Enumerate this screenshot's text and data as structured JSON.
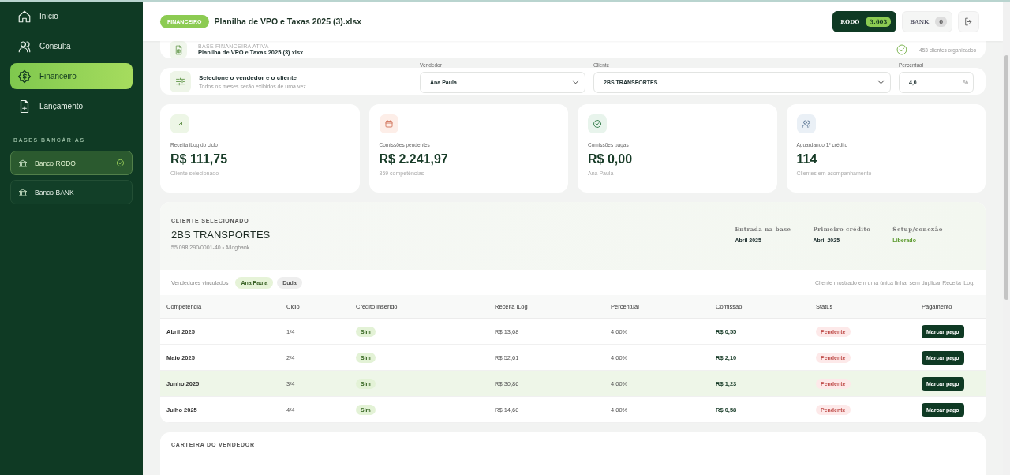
{
  "sidebar": {
    "nav": [
      {
        "label": "Início",
        "selected": false
      },
      {
        "label": "Consulta",
        "selected": false
      },
      {
        "label": "Financeiro",
        "selected": true
      },
      {
        "label": "Lançamento",
        "selected": false
      }
    ],
    "section_title": "BASES BANCÁRIAS",
    "banks": [
      {
        "label": "Banco RODO",
        "selected": true
      },
      {
        "label": "Banco BANK",
        "selected": false
      }
    ]
  },
  "header": {
    "tag": "FINANCEIRO",
    "title": "Planilha de VPO e Taxas 2025 (3).xlsx",
    "bases": [
      {
        "label": "RODO",
        "count": "3.603",
        "selected": true
      },
      {
        "label": "BANK",
        "count": "0",
        "selected": false
      }
    ]
  },
  "active_base": {
    "label": "BASE FINANCEIRA ATIVA",
    "file": "Planilha de VPO e Taxas 2025 (3).xlsx",
    "status": "453 clientes organizados"
  },
  "filter": {
    "title": "Selecione o vendedor e o cliente",
    "subtitle": "Todos os meses serão exibidos de uma vez.",
    "vendedor": {
      "label": "Vendedor",
      "value": "Ana Paula"
    },
    "cliente": {
      "label": "Cliente",
      "value": "2BS TRANSPORTES"
    },
    "percentual": {
      "label": "Percentual",
      "value": "4,0",
      "suffix": "%"
    }
  },
  "stats": [
    {
      "label": "Receita iLog do ciclo",
      "value": "R$ 111,75",
      "note": "Cliente selecionado"
    },
    {
      "label": "Comissões pendentes",
      "value": "R$ 2.241,97",
      "note": "359 competências"
    },
    {
      "label": "Comissões pagas",
      "value": "R$ 0,00",
      "note": "Ana Paula"
    },
    {
      "label": "Aguardando 1º crédito",
      "value": "114",
      "note": "Clientes em acompanhamento"
    }
  ],
  "client": {
    "section_label": "CLIENTE SELECIONADO",
    "name": "2BS TRANSPORTES",
    "document": "55.098.290/0001-40 • Ailogbank",
    "facts": [
      {
        "label": "Entrada na base",
        "value": "Abril 2025",
        "kind": "plain"
      },
      {
        "label": "Primeiro crédito",
        "value": "Abril 2025",
        "kind": "plain"
      },
      {
        "label": "Setup/conexão",
        "value": "Liberado",
        "kind": "status"
      }
    ],
    "vendors_label": "Vendedores vinculados",
    "vendors": [
      {
        "name": "Ana Paula",
        "selected": true
      },
      {
        "name": "Duda",
        "selected": false
      }
    ],
    "note": "Cliente mostrado em uma única linha, sem duplicar Receita iLog."
  },
  "table": {
    "columns": [
      "Competência",
      "Ciclo",
      "Crédito inserido",
      "Receita iLog",
      "Percentual",
      "Comissão",
      "Status",
      "Pagamento"
    ],
    "rows": [
      {
        "month": "Abril 2025",
        "cycle": "1/4",
        "credit": "Sim",
        "revenue": "R$ 13,68",
        "percent": "4,00%",
        "commission": "R$ 0,55",
        "status": "Pendente",
        "action": "Marcar pago",
        "selected": false
      },
      {
        "month": "Maio 2025",
        "cycle": "2/4",
        "credit": "Sim",
        "revenue": "R$ 52,61",
        "percent": "4,00%",
        "commission": "R$ 2,10",
        "status": "Pendente",
        "action": "Marcar pago",
        "selected": false
      },
      {
        "month": "Junho 2025",
        "cycle": "3/4",
        "credit": "Sim",
        "revenue": "R$ 30,86",
        "percent": "4,00%",
        "commission": "R$ 1,23",
        "status": "Pendente",
        "action": "Marcar pago",
        "selected": true
      },
      {
        "month": "Julho 2025",
        "cycle": "4/4",
        "credit": "Sim",
        "revenue": "R$ 14,60",
        "percent": "4,00%",
        "commission": "R$ 0,58",
        "status": "Pendente",
        "action": "Marcar pago",
        "selected": false
      }
    ]
  },
  "next_section": {
    "label": "CARTEIRA DO VENDEDOR"
  }
}
